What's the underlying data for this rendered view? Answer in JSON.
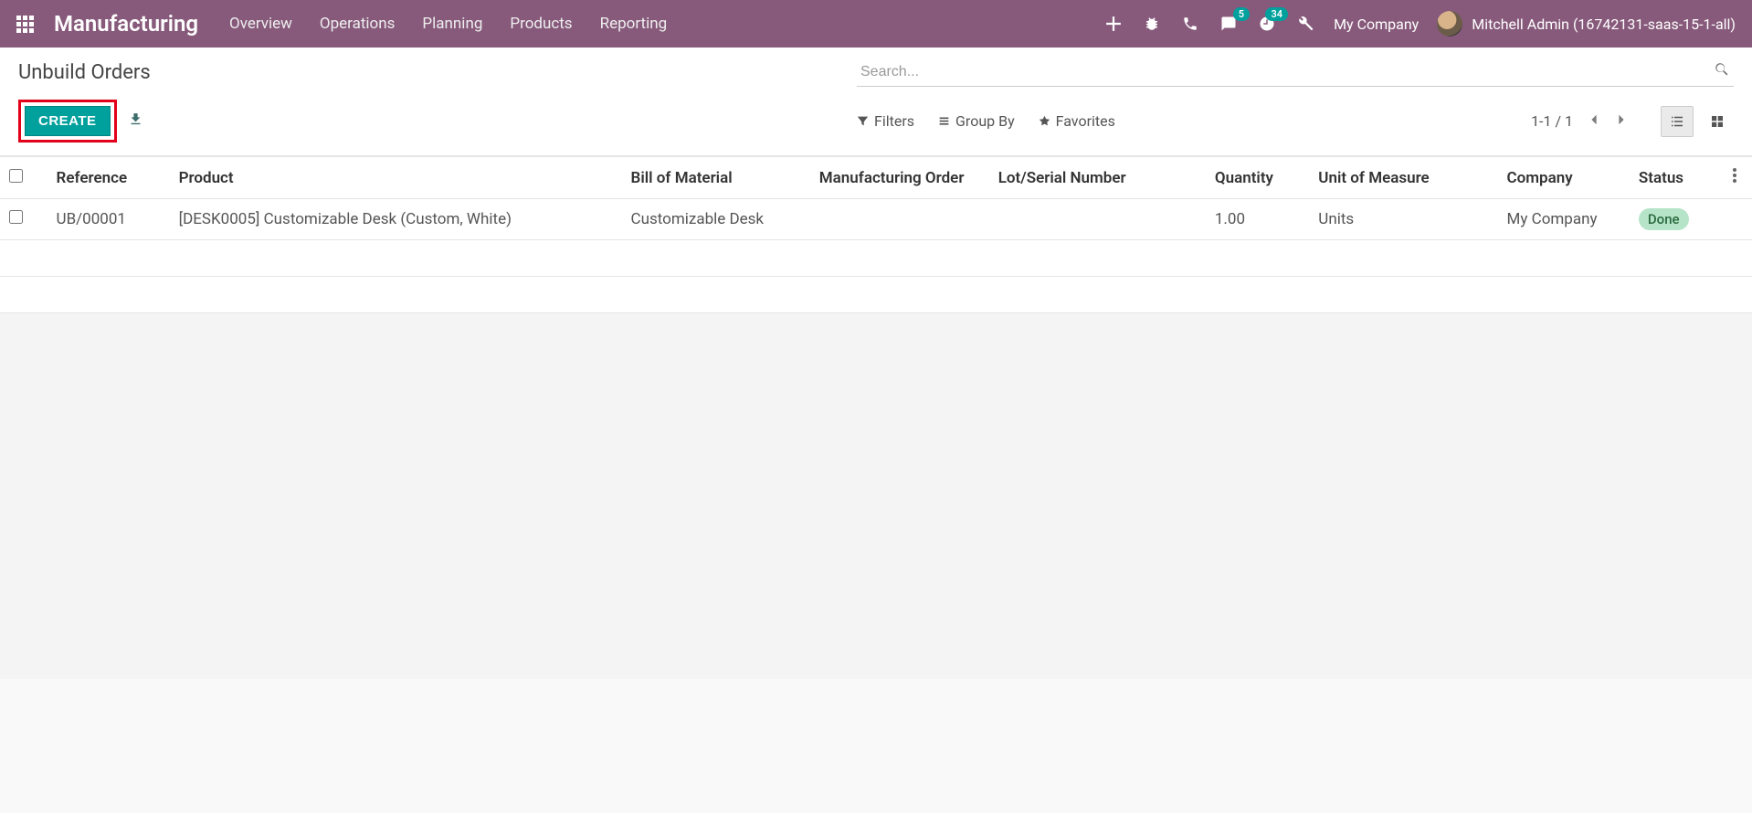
{
  "navbar": {
    "brand": "Manufacturing",
    "menu": [
      "Overview",
      "Operations",
      "Planning",
      "Products",
      "Reporting"
    ],
    "company": "My Company",
    "user": "Mitchell Admin (16742131-saas-15-1-all)",
    "messages_badge": "5",
    "activities_badge": "34"
  },
  "breadcrumb": "Unbuild Orders",
  "search": {
    "placeholder": "Search..."
  },
  "buttons": {
    "create": "CREATE"
  },
  "search_options": {
    "filters": "Filters",
    "groupby": "Group By",
    "favorites": "Favorites"
  },
  "pager": {
    "text": "1-1 / 1"
  },
  "columns": {
    "reference": "Reference",
    "product": "Product",
    "bom": "Bill of Material",
    "mo": "Manufacturing Order",
    "lot": "Lot/Serial Number",
    "qty": "Quantity",
    "uom": "Unit of Measure",
    "company": "Company",
    "status": "Status"
  },
  "rows": [
    {
      "reference": "UB/00001",
      "product": "[DESK0005] Customizable Desk (Custom, White)",
      "bom": "Customizable Desk",
      "mo": "",
      "lot": "",
      "qty": "1.00",
      "uom": "Units",
      "company": "My Company",
      "status": "Done"
    }
  ]
}
